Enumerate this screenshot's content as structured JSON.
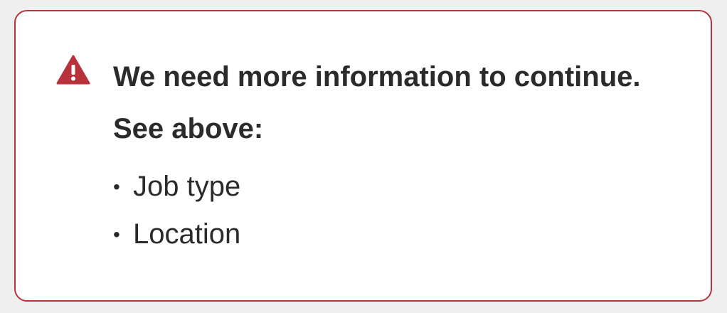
{
  "alert": {
    "icon": "warning-triangle-icon",
    "accent_color": "#b8323b",
    "title": "We need more information to continue. See above:",
    "missing_fields": [
      "Job type",
      "Location"
    ]
  }
}
